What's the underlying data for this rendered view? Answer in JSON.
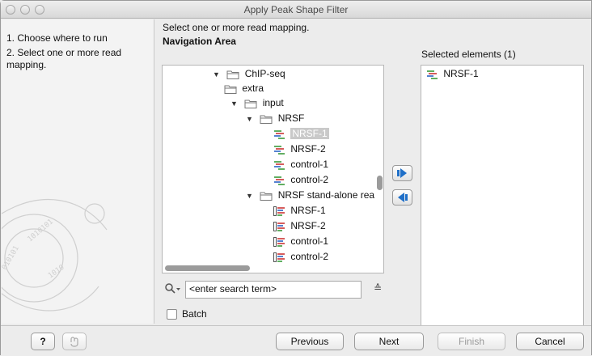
{
  "window": {
    "title": "Apply Peak Shape Filter"
  },
  "steps": [
    {
      "label": "1. Choose where to run"
    },
    {
      "label": "2. Select one or more read mapping."
    }
  ],
  "instruction": "Select one or more read mapping.",
  "navigation_title": "Navigation Area",
  "selected_title": "Selected elements (1)",
  "tree": [
    {
      "label": "ChIP-seq",
      "icon": "folder-icon",
      "arrow": "▼"
    },
    {
      "label": "extra",
      "icon": "folder-icon",
      "arrow": ""
    },
    {
      "label": "input",
      "icon": "folder-icon",
      "arrow": "▼"
    },
    {
      "label": "NRSF",
      "icon": "folder-icon",
      "arrow": "▼"
    },
    {
      "label": "NRSF-1",
      "icon": "read-mapping-icon",
      "arrow": ""
    },
    {
      "label": "NRSF-2",
      "icon": "read-mapping-icon",
      "arrow": ""
    },
    {
      "label": "control-1",
      "icon": "read-mapping-icon",
      "arrow": ""
    },
    {
      "label": "control-2",
      "icon": "read-mapping-icon",
      "arrow": ""
    },
    {
      "label": "NRSF stand-alone rea",
      "icon": "folder-icon",
      "arrow": "▼"
    },
    {
      "label": "NRSF-1",
      "icon": "track-icon",
      "arrow": ""
    },
    {
      "label": "NRSF-2",
      "icon": "track-icon",
      "arrow": ""
    },
    {
      "label": "control-1",
      "icon": "track-icon",
      "arrow": ""
    },
    {
      "label": "control-2",
      "icon": "track-icon",
      "arrow": ""
    }
  ],
  "selected_elements": [
    {
      "label": "NRSF-1",
      "icon": "read-mapping-icon"
    }
  ],
  "search": {
    "placeholder": "<enter search term>",
    "value": ""
  },
  "batch": {
    "label": "Batch",
    "checked": false
  },
  "buttons": {
    "help": "?",
    "previous": "Previous",
    "next": "Next",
    "finish": "Finish",
    "cancel": "Cancel"
  }
}
